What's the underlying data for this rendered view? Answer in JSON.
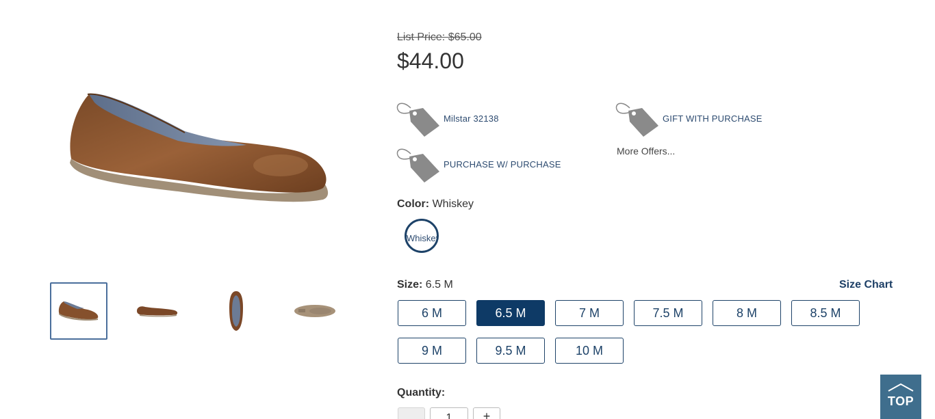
{
  "product": {
    "list_price": "List Price: $65.00",
    "price": "$44.00",
    "main_image_icon": "shoe-image"
  },
  "gallery": {
    "thumbnails": [
      {
        "icon": "shoe-three-quarter-thumbnail",
        "selected": true
      },
      {
        "icon": "shoe-side-thumbnail",
        "selected": false
      },
      {
        "icon": "shoe-top-thumbnail",
        "selected": false
      },
      {
        "icon": "shoe-sole-thumbnail",
        "selected": false
      }
    ]
  },
  "offers": {
    "items": [
      {
        "label": "Milstar 32138",
        "icon": "price-tag-icon"
      },
      {
        "label": "GIFT WITH PURCHASE",
        "icon": "price-tag-icon"
      },
      {
        "label": "PURCHASE W/ PURCHASE",
        "icon": "price-tag-icon"
      }
    ],
    "more": "More Offers..."
  },
  "color": {
    "label": "Color:",
    "value": "Whiskey",
    "swatch_alt": "Whiskey"
  },
  "size": {
    "label": "Size:",
    "value": "6.5 M",
    "chart_link": "Size Chart",
    "options": [
      "6 M",
      "6.5 M",
      "7 M",
      "7.5 M",
      "8 M",
      "8.5 M",
      "9 M",
      "9.5 M",
      "10 M"
    ],
    "selected": "6.5 M"
  },
  "quantity": {
    "label": "Quantity:",
    "value": "1",
    "minus": "",
    "plus": "+"
  },
  "top_button": {
    "label": "TOP",
    "icon": "chevron-up-icon"
  },
  "colors": {
    "accent": "#0e3a66",
    "link": "#2d4b70",
    "top_button_bg": "#3f6e8d",
    "shoe_leather": "#8a5530"
  }
}
